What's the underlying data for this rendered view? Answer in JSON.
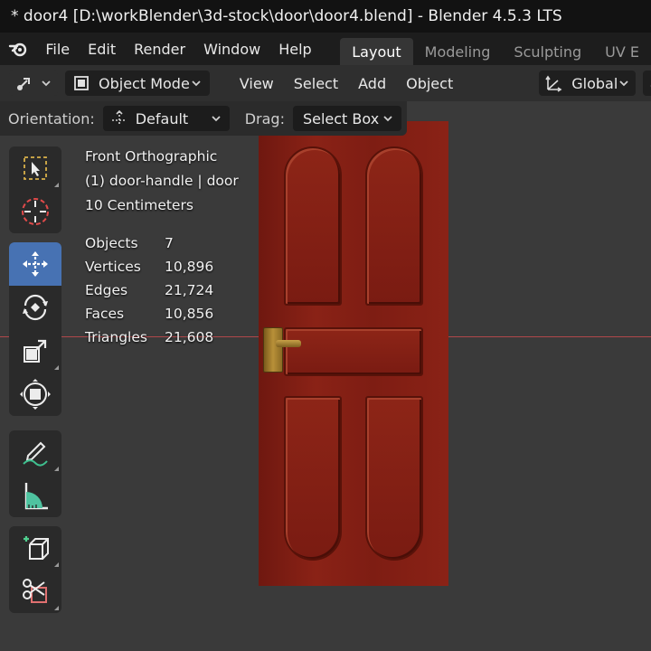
{
  "window": {
    "title": "* door4 [D:\\workBlender\\3d-stock\\door\\door4.blend] - Blender 4.5.3 LTS"
  },
  "menubar": {
    "items": [
      "File",
      "Edit",
      "Render",
      "Window",
      "Help"
    ],
    "workspaces": [
      "Layout",
      "Modeling",
      "Sculpting",
      "UV E"
    ],
    "active_workspace": "Layout"
  },
  "header": {
    "mode": "Object Mode",
    "menus": [
      "View",
      "Select",
      "Add",
      "Object"
    ],
    "transform_orientation": "Global"
  },
  "tool_settings": {
    "orientation_label": "Orientation:",
    "orientation_value": "Default",
    "drag_label": "Drag:",
    "drag_value": "Select Box"
  },
  "toolbar": {
    "icons": [
      "select-box-icon",
      "cursor-icon",
      "move-icon",
      "rotate-icon",
      "scale-icon",
      "transform-icon",
      "annotate-icon",
      "measure-icon",
      "add-cube-icon",
      "cut-icon"
    ],
    "active": "move-icon"
  },
  "overlay": {
    "view_name": "Front Orthographic",
    "selection": "(1) door-handle | door",
    "grid_scale": "10 Centimeters"
  },
  "stats": [
    {
      "label": "Objects",
      "value": "7"
    },
    {
      "label": "Vertices",
      "value": "10,896"
    },
    {
      "label": "Edges",
      "value": "21,724"
    },
    {
      "label": "Faces",
      "value": "10,856"
    },
    {
      "label": "Triangles",
      "value": "21,608"
    }
  ],
  "colors": {
    "accent": "#4772b3",
    "x_axis": "#b0474b",
    "door": "#7e1d13"
  }
}
